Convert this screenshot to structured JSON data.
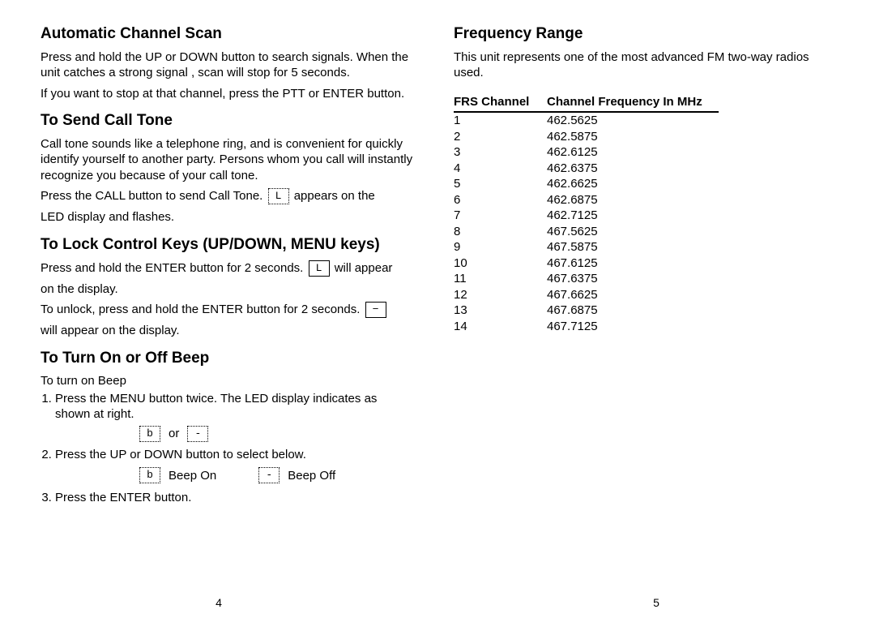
{
  "left": {
    "s1": {
      "title": "Automatic Channel Scan",
      "p1": "Press and hold the UP or DOWN button to search signals. When the unit catches a strong signal , scan will stop for 5 seconds.",
      "p2": "If you want to stop at that channel, press the PTT or ENTER button."
    },
    "s2": {
      "title": "To Send Call Tone",
      "p1": "Call tone sounds like a telephone ring, and is convenient for quickly identify yourself to another party. Persons whom you call will instantly recognize you because of your call tone.",
      "p2a": "Press the CALL button to send Call Tone.",
      "icon": "L",
      "p2b": "appears on the",
      "p3": "LED display and flashes."
    },
    "s3": {
      "title": "To Lock Control Keys (UP/DOWN, MENU keys)",
      "p1a": "Press and hold the ENTER button for 2 seconds.",
      "icon1": "L",
      "p1b": "will appear",
      "p2": "on the display.",
      "p3a": "To unlock, press and hold the ENTER button for 2 seconds.",
      "icon2": "−",
      "p4": "will appear on the display."
    },
    "s4": {
      "title": "To Turn On or Off Beep",
      "intro": "To turn on Beep",
      "li1": "Press the MENU button twice. The LED display indicates as shown at right.",
      "iconA": "b",
      "or": "or",
      "iconB": "-",
      "li2": "Press the UP or DOWN button to select below.",
      "iconOn": "b",
      "labelOn": "Beep On",
      "iconOff": "-",
      "labelOff": "Beep Off",
      "li3": "Press the ENTER button."
    },
    "page": "4"
  },
  "right": {
    "title": "Frequency Range",
    "intro": "This unit represents one of the most advanced FM two-way radios used.",
    "th1": "FRS Channel",
    "th2": "Channel Frequency In MHz",
    "rows": [
      {
        "ch": "1",
        "f": "462.5625"
      },
      {
        "ch": "2",
        "f": "462.5875"
      },
      {
        "ch": "3",
        "f": "462.6125"
      },
      {
        "ch": "4",
        "f": "462.6375"
      },
      {
        "ch": "5",
        "f": "462.6625"
      },
      {
        "ch": "6",
        "f": "462.6875"
      },
      {
        "ch": "7",
        "f": "462.7125"
      },
      {
        "ch": "8",
        "f": "467.5625"
      },
      {
        "ch": "9",
        "f": "467.5875"
      },
      {
        "ch": "10",
        "f": "467.6125"
      },
      {
        "ch": "11",
        "f": "467.6375"
      },
      {
        "ch": "12",
        "f": "467.6625"
      },
      {
        "ch": "13",
        "f": "467.6875"
      },
      {
        "ch": "14",
        "f": "467.7125"
      }
    ],
    "page": "5"
  }
}
